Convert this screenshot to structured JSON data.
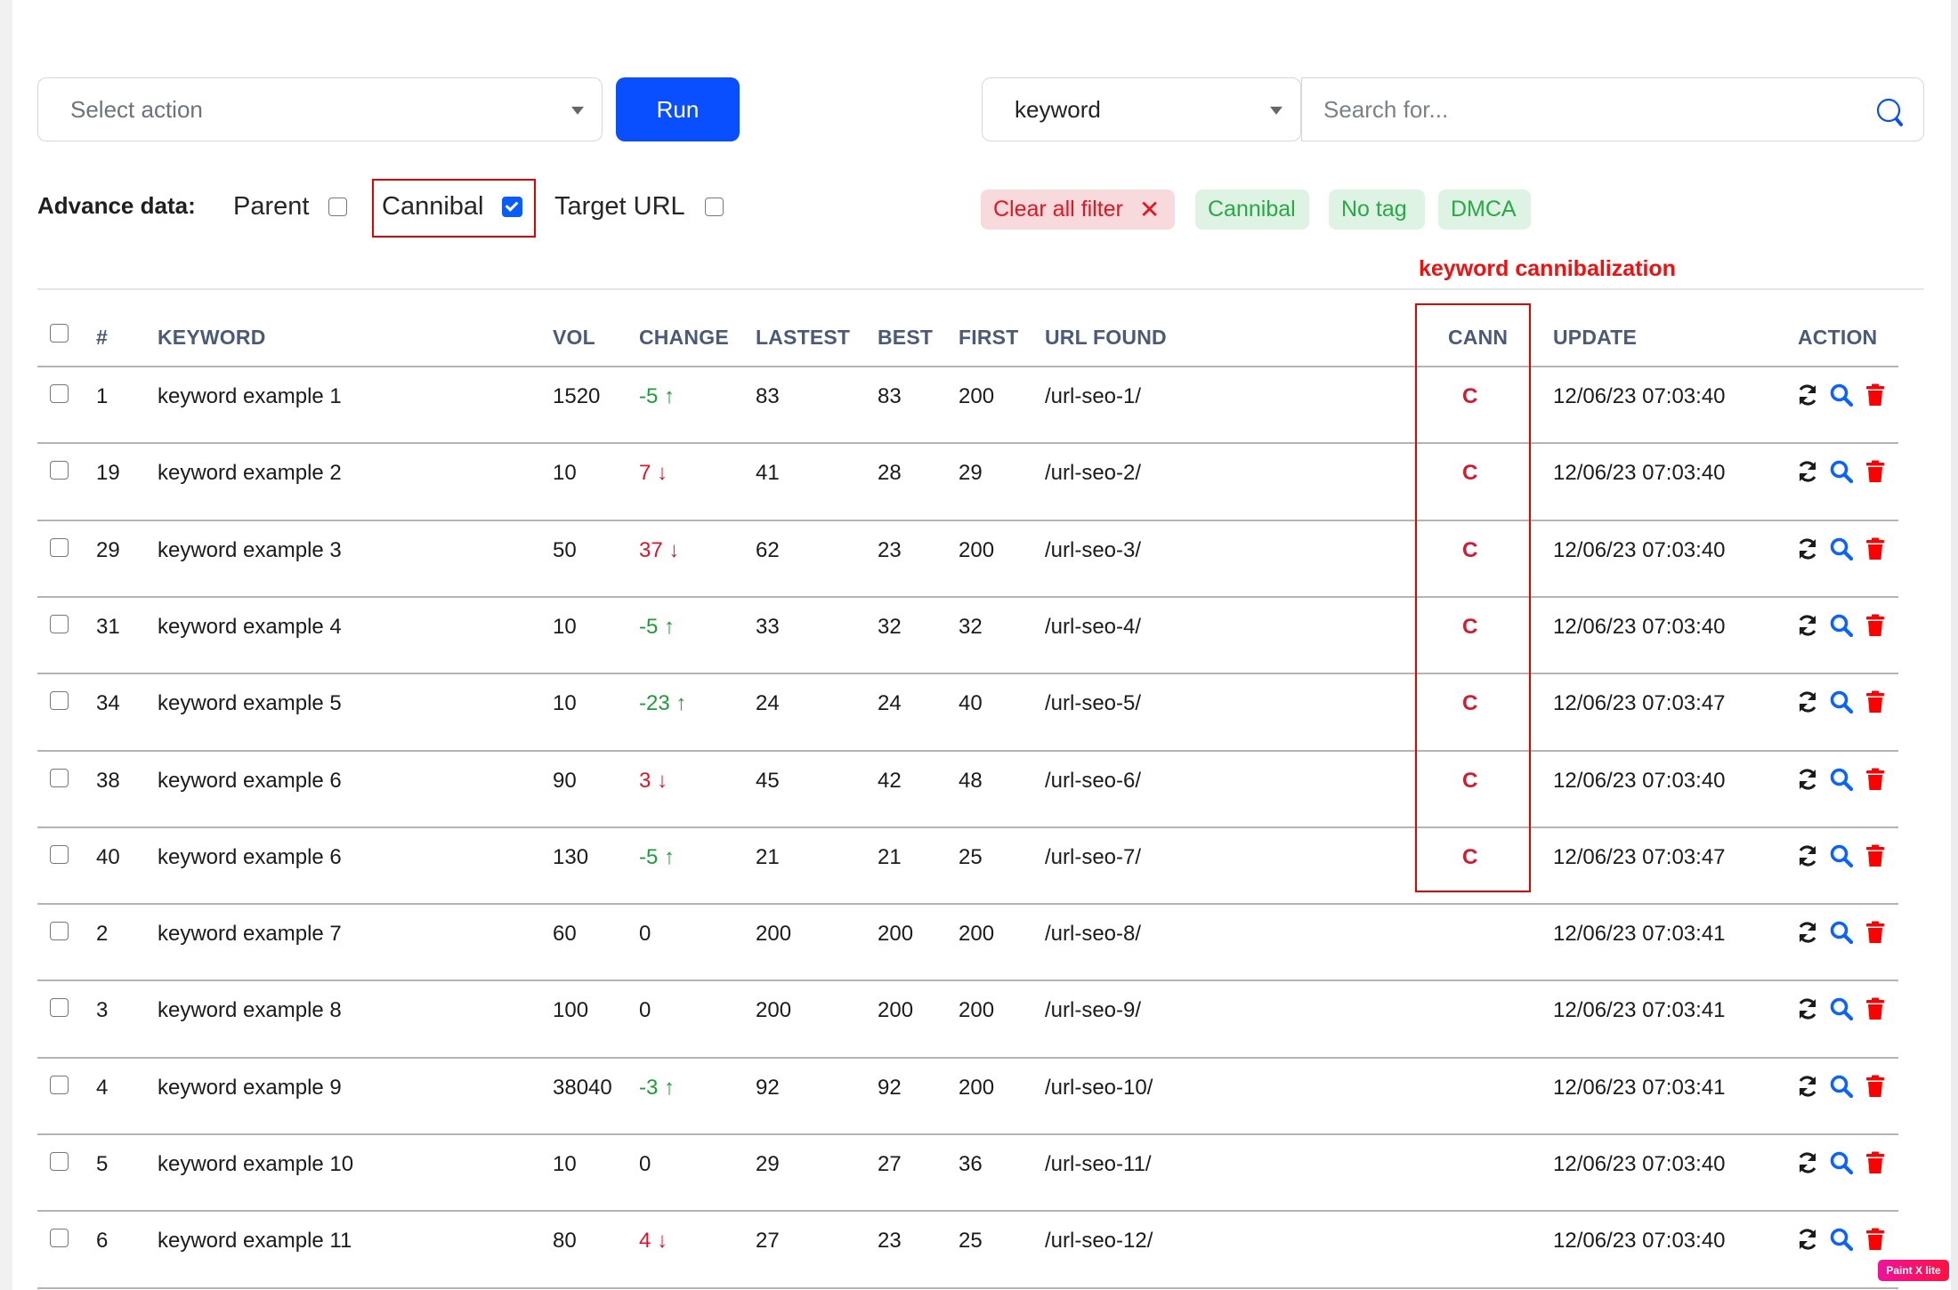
{
  "toolbar": {
    "action_select": {
      "placeholder": "Select action"
    },
    "run_label": "Run",
    "field_select": {
      "value": "keyword"
    },
    "search": {
      "placeholder": "Search for...",
      "value": ""
    }
  },
  "advance_data": {
    "label": "Advance data:",
    "options": [
      {
        "label": "Parent",
        "checked": false
      },
      {
        "label": "Cannibal",
        "checked": true
      },
      {
        "label": "Target URL",
        "checked": false
      }
    ]
  },
  "filters": {
    "clear_label": "Clear all filter",
    "clear_icon": "close-icon",
    "tags": [
      "Cannibal",
      "No tag",
      "DMCA"
    ]
  },
  "annotation": "keyword cannibalization",
  "colors": {
    "primary": "#0a4fff",
    "up": "#1e9e3a",
    "down": "#e0132b",
    "highlight": "#e60000",
    "cann": "#d31b33",
    "search_icon": "#0a4fff",
    "delete_icon": "#ff0000"
  },
  "table": {
    "columns": [
      "#",
      "KEYWORD",
      "VOL",
      "CHANGE",
      "LASTEST",
      "BEST",
      "FIRST",
      "URL FOUND",
      "CANN",
      "UPDATE",
      "ACTION"
    ],
    "action_icons": [
      "refresh-icon",
      "search-icon",
      "trash-icon"
    ],
    "rows": [
      {
        "id": "1",
        "keyword": "keyword example 1",
        "vol": "1520",
        "change": "-5",
        "dir": "up",
        "lastest": "83",
        "best": "83",
        "first": "200",
        "url": "/url-seo-1/",
        "cann": "C",
        "update": "12/06/23 07:03:40"
      },
      {
        "id": "19",
        "keyword": "keyword example 2",
        "vol": "10",
        "change": "7",
        "dir": "down",
        "lastest": "41",
        "best": "28",
        "first": "29",
        "url": "/url-seo-2/",
        "cann": "C",
        "update": "12/06/23 07:03:40"
      },
      {
        "id": "29",
        "keyword": "keyword example 3",
        "vol": "50",
        "change": "37",
        "dir": "down",
        "lastest": "62",
        "best": "23",
        "first": "200",
        "url": "/url-seo-3/",
        "cann": "C",
        "update": "12/06/23 07:03:40"
      },
      {
        "id": "31",
        "keyword": "keyword example 4",
        "vol": "10",
        "change": "-5",
        "dir": "up",
        "lastest": "33",
        "best": "32",
        "first": "32",
        "url": "/url-seo-4/",
        "cann": "C",
        "update": "12/06/23 07:03:40"
      },
      {
        "id": "34",
        "keyword": "keyword example 5",
        "vol": "10",
        "change": "-23",
        "dir": "up",
        "lastest": "24",
        "best": "24",
        "first": "40",
        "url": "/url-seo-5/",
        "cann": "C",
        "update": "12/06/23 07:03:47"
      },
      {
        "id": "38",
        "keyword": "keyword example 6",
        "vol": "90",
        "change": "3",
        "dir": "down",
        "lastest": "45",
        "best": "42",
        "first": "48",
        "url": "/url-seo-6/",
        "cann": "C",
        "update": "12/06/23 07:03:40"
      },
      {
        "id": "40",
        "keyword": "keyword example 6",
        "vol": "130",
        "change": "-5",
        "dir": "up",
        "lastest": "21",
        "best": "21",
        "first": "25",
        "url": "/url-seo-7/",
        "cann": "C",
        "update": "12/06/23 07:03:47"
      },
      {
        "id": "2",
        "keyword": "keyword example 7",
        "vol": "60",
        "change": "0",
        "dir": "none",
        "lastest": "200",
        "best": "200",
        "first": "200",
        "url": "/url-seo-8/",
        "cann": "",
        "update": "12/06/23 07:03:41"
      },
      {
        "id": "3",
        "keyword": "keyword example 8",
        "vol": "100",
        "change": "0",
        "dir": "none",
        "lastest": "200",
        "best": "200",
        "first": "200",
        "url": "/url-seo-9/",
        "cann": "",
        "update": "12/06/23 07:03:41"
      },
      {
        "id": "4",
        "keyword": "keyword example 9",
        "vol": "38040",
        "change": "-3",
        "dir": "up",
        "lastest": "92",
        "best": "92",
        "first": "200",
        "url": "/url-seo-10/",
        "cann": "",
        "update": "12/06/23 07:03:41"
      },
      {
        "id": "5",
        "keyword": "keyword example 10",
        "vol": "10",
        "change": "0",
        "dir": "none",
        "lastest": "29",
        "best": "27",
        "first": "36",
        "url": "/url-seo-11/",
        "cann": "",
        "update": "12/06/23 07:03:40"
      },
      {
        "id": "6",
        "keyword": "keyword example 11",
        "vol": "80",
        "change": "4",
        "dir": "down",
        "lastest": "27",
        "best": "23",
        "first": "25",
        "url": "/url-seo-12/",
        "cann": "",
        "update": "12/06/23 07:03:40"
      }
    ]
  },
  "watermark": "Paint X lite"
}
